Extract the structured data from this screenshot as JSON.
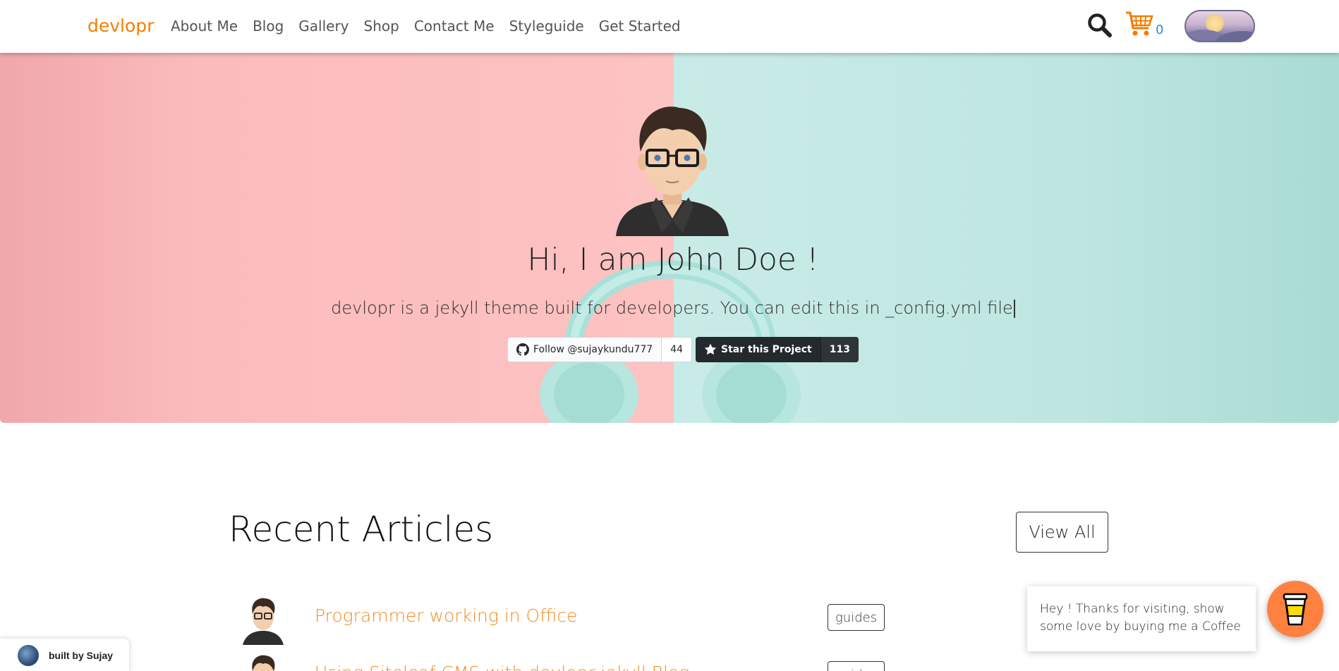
{
  "navbar": {
    "brand": "devlopr",
    "links": [
      "About Me",
      "Blog",
      "Gallery",
      "Shop",
      "Contact Me",
      "Styleguide",
      "Get Started"
    ],
    "cart_count": "0",
    "icons": {
      "search": "search-icon",
      "cart": "cart-icon",
      "theme": "theme-toggle-icon"
    }
  },
  "hero": {
    "title": "Hi, I am John Doe !",
    "subtitle": "devlopr is a jekyll theme built for developers. You can edit this in _config.yml file",
    "follow_label": "Follow @sujaykundu777",
    "follow_count": "44",
    "star_label": "Star this Project",
    "star_count": "113",
    "colors": {
      "left": "#fdc2c2",
      "right": "#bfe6e1"
    }
  },
  "recent": {
    "title": "Recent Articles",
    "view_all": "View All",
    "articles": [
      {
        "title": "Programmer working in Office",
        "tag": "guides"
      },
      {
        "title": "Using Siteleaf CMS with devlopr-jekyll Blog",
        "tag": "guides"
      }
    ]
  },
  "built_by": "built by Sujay",
  "coffee": {
    "message": "Hey ! Thanks for visiting, show some love by buying me a Coffee"
  },
  "accent": "#f58a1f"
}
